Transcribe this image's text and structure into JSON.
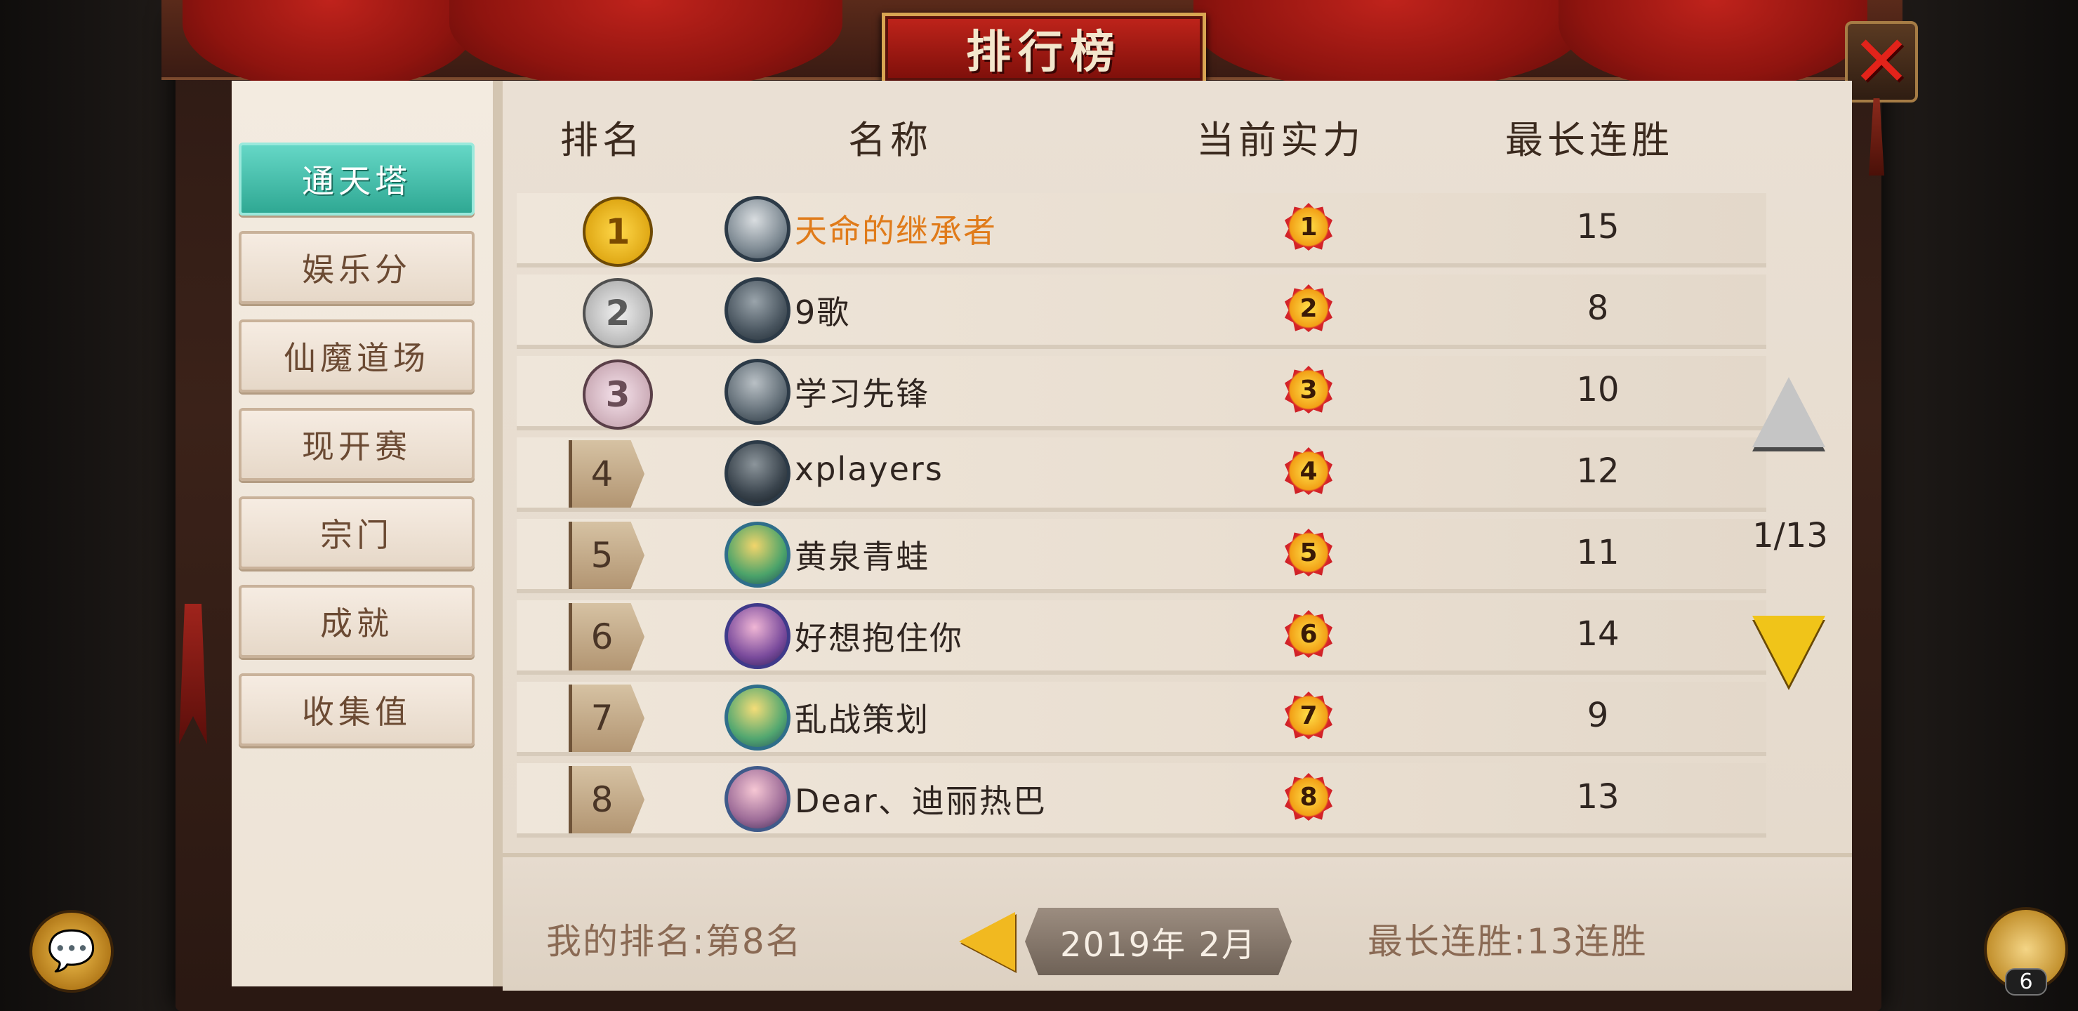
{
  "title": "排行榜",
  "close_icon": "close-icon",
  "tabs": [
    {
      "label": "通天塔",
      "active": true
    },
    {
      "label": "娱乐分",
      "active": false
    },
    {
      "label": "仙魔道场",
      "active": false
    },
    {
      "label": "现开赛",
      "active": false
    },
    {
      "label": "宗门",
      "active": false
    },
    {
      "label": "成就",
      "active": false
    },
    {
      "label": "收集值",
      "active": false
    }
  ],
  "headers": {
    "rank": "排名",
    "name": "名称",
    "power": "当前实力",
    "streak": "最长连胜"
  },
  "rows": [
    {
      "rank": "1",
      "name": "天命的继承者",
      "power": "1",
      "streak": "15"
    },
    {
      "rank": "2",
      "name": "9歌",
      "power": "2",
      "streak": "8"
    },
    {
      "rank": "3",
      "name": "学习先锋",
      "power": "3",
      "streak": "10"
    },
    {
      "rank": "4",
      "name": "xplayers",
      "power": "4",
      "streak": "12"
    },
    {
      "rank": "5",
      "name": "黄泉青蛙",
      "power": "5",
      "streak": "11"
    },
    {
      "rank": "6",
      "name": "好想抱住你",
      "power": "6",
      "streak": "14"
    },
    {
      "rank": "7",
      "name": "乱战策划",
      "power": "7",
      "streak": "9"
    },
    {
      "rank": "8",
      "name": "Dear、迪丽热巴",
      "power": "8",
      "streak": "13"
    }
  ],
  "pagination": {
    "current": "1/13"
  },
  "footer": {
    "my_rank": "我的排名:第8名",
    "month": "2019年 2月",
    "best_streak": "最长连胜:13连胜"
  },
  "friends_count": "6",
  "colors": {
    "accent_tab": "#3fbfab",
    "top_rank_name": "#e07b1a",
    "down_arrow": "#f0c419",
    "curtain": "#b01a14"
  }
}
